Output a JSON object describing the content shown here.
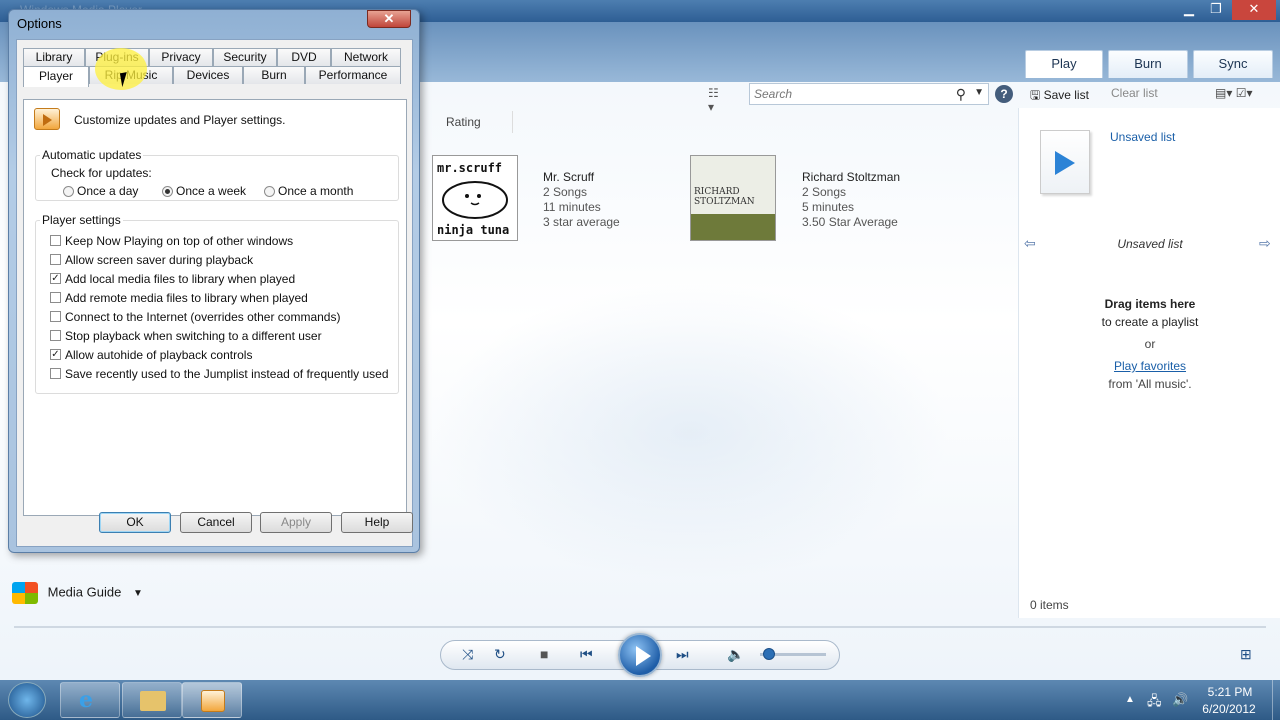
{
  "wmp": {
    "title": "Windows Media Player",
    "window_controls": {
      "minimize": "▁",
      "maximize": "❐",
      "close": "✕"
    },
    "tabs": [
      {
        "label": "Play"
      },
      {
        "label": "Burn"
      },
      {
        "label": "Sync"
      }
    ],
    "search": {
      "placeholder": "Search"
    },
    "help": "?",
    "columns": {
      "rating": "Rating"
    },
    "albums": [
      {
        "art_text": "mr.scruff ninja tuna",
        "artist": "Mr. Scruff",
        "songs": "2 Songs",
        "length": "11 minutes",
        "rating": "3 star average"
      },
      {
        "art_text": "RICHARD STOLTZMAN",
        "artist": "Richard Stoltzman",
        "songs": "2 Songs",
        "length": "5 minutes",
        "rating": "3.50 Star Average"
      }
    ],
    "list_pane": {
      "save_list": "Save list",
      "clear_list": "Clear list",
      "unsaved_list_title": "Unsaved list",
      "unsaved_list_nav": "Unsaved list",
      "drag_here": "Drag items here",
      "to_create": "to create a playlist",
      "or": "or",
      "play_favorites": "Play favorites",
      "from_all_music": "from 'All music'.",
      "items_count": "0 items"
    },
    "media_guide": "Media Guide"
  },
  "taskbar": {
    "time": "5:21 PM",
    "date": "6/20/2012"
  },
  "options": {
    "title": "Options",
    "close": "✕",
    "tabs_row1": [
      "Library",
      "Plug-ins",
      "Privacy",
      "Security",
      "DVD",
      "Network"
    ],
    "tabs_row2": [
      "Player",
      "Rip Music",
      "Devices",
      "Burn",
      "Performance"
    ],
    "description": "Customize updates and Player settings.",
    "auto_updates": {
      "group": "Automatic updates",
      "check_label": "Check for updates:",
      "options": [
        "Once a day",
        "Once a week",
        "Once a month"
      ],
      "selected": "Once a week"
    },
    "player_settings": {
      "group": "Player settings",
      "items": [
        {
          "label": "Keep Now Playing on top of other windows",
          "checked": false
        },
        {
          "label": "Allow screen saver during playback",
          "checked": false
        },
        {
          "label": "Add local media files to library when played",
          "checked": true
        },
        {
          "label": "Add remote media files to library when played",
          "checked": false
        },
        {
          "label": "Connect to the Internet (overrides other commands)",
          "checked": false
        },
        {
          "label": "Stop playback when switching to a different user",
          "checked": false
        },
        {
          "label": "Allow autohide of playback controls",
          "checked": true
        },
        {
          "label": "Save recently used to the Jumplist instead of frequently used",
          "checked": false
        }
      ]
    },
    "buttons": {
      "ok": "OK",
      "cancel": "Cancel",
      "apply": "Apply",
      "help": "Help"
    }
  },
  "colors": {
    "accent": "#2c83d6",
    "link": "#1a5fa8",
    "titlebar": "#3a6a9e"
  }
}
